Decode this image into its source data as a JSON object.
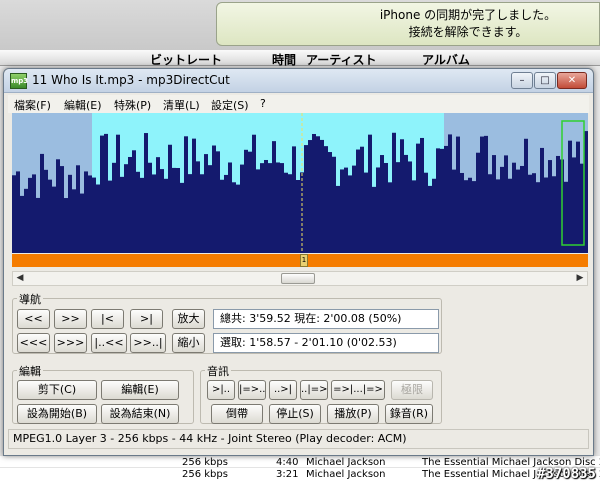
{
  "notification": {
    "line1": "iPhone の同期が完了しました。",
    "line2": "接続を解除できます。"
  },
  "background_table": {
    "headers": [
      "ビットレート",
      "時間",
      "アーティスト",
      "アルバム"
    ],
    "rows": [
      {
        "bitrate": "256 kbps",
        "time": "4:40",
        "artist": "Michael Jackson",
        "album": "The Essential Michael Jackson Disc 2"
      },
      {
        "bitrate": "256 kbps",
        "time": "3:21",
        "artist": "Michael Jackson",
        "album": "The Essential Michael Jackson Disc 2"
      }
    ]
  },
  "watermark": "#370835",
  "window": {
    "title": "11 Who Is It.mp3 - mp3DirectCut",
    "icon_label": "mp3",
    "controls": {
      "minimize": "–",
      "maximize": "□",
      "close": "✕"
    }
  },
  "menu": [
    "檔案(F)",
    "編輯(E)",
    "特殊(P)",
    "清單(L)",
    "設定(S)",
    "?"
  ],
  "waveform": {
    "background_color": "#141a6e",
    "selection_color": "#8ef3fb",
    "unselected_color": "#9bbde0",
    "cursor_color": "#f0e060",
    "marker_color": "#30d030",
    "marker_label": "1"
  },
  "navigation": {
    "label": "導航",
    "row1": [
      "<<",
      ">>",
      "|<",
      ">|"
    ],
    "row2": [
      "<<<",
      ">>>",
      "|..<<",
      ">>..|"
    ],
    "zoom_in": "放大",
    "zoom_out": "縮小",
    "total_info": "總共: 3'59.52   現在: 2'00.08   (50%)",
    "selection_info": "選取: 1'58.57 - 2'01.10 (0'02.53)"
  },
  "edit": {
    "label": "編輯",
    "cut": "剪下(C)",
    "edit": "編輯(E)",
    "set_start": "設為開始(B)",
    "set_end": "設為結束(N)"
  },
  "audio": {
    "label": "音訊",
    "row1": [
      ">|..",
      "|=>..",
      "..>|",
      "..|=>",
      "=>|...|=>",
      "極限"
    ],
    "row2": [
      "倒帶",
      "停止(S)",
      "播放(P)",
      "錄音(R)"
    ]
  },
  "status": "MPEG1.0 Layer 3 - 256 kbps - 44 kHz - Joint Stereo   (Play decoder: ACM)"
}
